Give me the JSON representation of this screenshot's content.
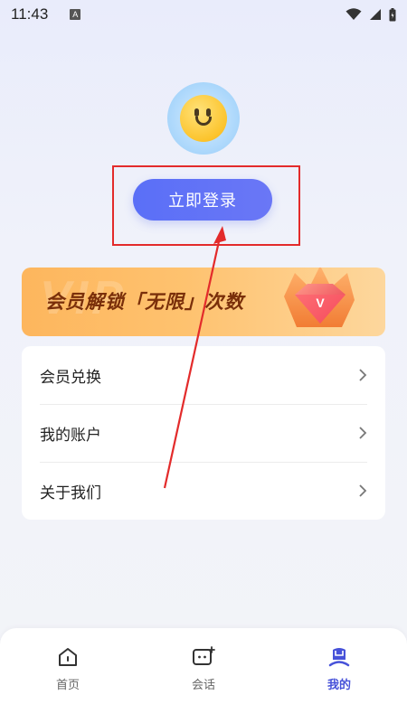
{
  "status_bar": {
    "time": "11:43",
    "indicator": "A",
    "icons": [
      "wifi-icon",
      "signal-icon",
      "battery-icon"
    ]
  },
  "profile": {
    "avatar": "smiley-face-icon",
    "login_label": "立即登录"
  },
  "vip_banner": {
    "text": "会员解锁「无限」次数",
    "watermark": "VIP",
    "gem_letter": "V"
  },
  "menu": {
    "items": [
      {
        "label": "会员兑换"
      },
      {
        "label": "我的账户"
      },
      {
        "label": "关于我们"
      }
    ]
  },
  "tab_bar": {
    "tabs": [
      {
        "label": "首页",
        "icon": "home-icon",
        "active": false
      },
      {
        "label": "会话",
        "icon": "chat-icon",
        "active": false
      },
      {
        "label": "我的",
        "icon": "user-icon",
        "active": true
      }
    ]
  },
  "colors": {
    "accent": "#5a6ff7",
    "active_tab": "#4752d9",
    "highlight": "#e32b2b"
  }
}
